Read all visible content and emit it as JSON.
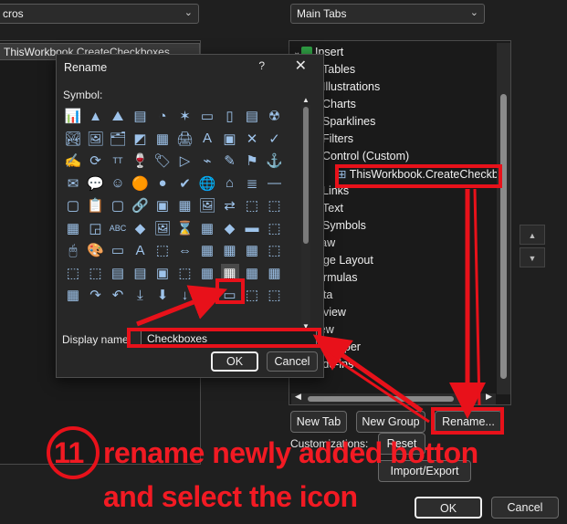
{
  "background": {
    "left_dropdown_value": "cros",
    "right_dropdown_value": "Main Tabs",
    "left_list_selected": "ThisWorkbook.CreateCheckboxes",
    "tree_items": [
      {
        "label": "Insert",
        "arrow": "down",
        "checkbox": true
      },
      {
        "label": "Tables",
        "arrow": "right"
      },
      {
        "label": "Illustrations",
        "arrow": "right"
      },
      {
        "label": "Charts",
        "arrow": "right"
      },
      {
        "label": "Sparklines",
        "arrow": "right"
      },
      {
        "label": "Filters",
        "arrow": "right"
      },
      {
        "label": "Control (Custom)",
        "arrow": "down"
      },
      {
        "label": "ThisWorkbook.CreateCheckb",
        "arrow": ""
      },
      {
        "label": "Links",
        "arrow": "right"
      },
      {
        "label": "Text",
        "arrow": "right"
      },
      {
        "label": "Symbols",
        "arrow": "right"
      },
      {
        "label": "raw",
        "arrow": ""
      },
      {
        "label": "age Layout",
        "arrow": ""
      },
      {
        "label": "ormulas",
        "arrow": ""
      },
      {
        "label": "ata",
        "arrow": ""
      },
      {
        "label": "eview",
        "arrow": ""
      },
      {
        "label": "iew",
        "arrow": ""
      },
      {
        "label": "eveloper",
        "arrow": ""
      },
      {
        "label": "Add-ins",
        "arrow": "",
        "checkbox": true
      }
    ],
    "new_tab_label": "New Tab",
    "new_group_label": "New Group",
    "rename_label": "Rename...",
    "customizations_label": "Customizations:",
    "reset_label": "Reset",
    "import_export_label": "Import/Export",
    "ok_label": "OK",
    "cancel_label": "Cancel"
  },
  "rename_dialog": {
    "title": "Rename",
    "help_glyph": "?",
    "close_glyph": "✕",
    "symbol_label": "Symbol:",
    "display_name_label": "Display name",
    "display_name_value": "Checkboxes",
    "ok_label": "OK",
    "cancel_label": "Cancel",
    "symbols": [
      [
        "📊",
        "▲",
        "⛰",
        "▤",
        "◔",
        "✶",
        "▭",
        "▯",
        "▤",
        "☢"
      ],
      [
        "🏞",
        "🖼",
        "🗂",
        "◩",
        "▦",
        "🖨",
        "A",
        "▣",
        "✕",
        "✓"
      ],
      [
        "✍",
        "⟳",
        "TT",
        "🍷",
        "🏷",
        "▷",
        "⌁",
        "✎",
        "⚑",
        "⚓"
      ],
      [
        "✉",
        "💬",
        "☺",
        "🟠",
        "●",
        "✔",
        "🌐",
        "⌂",
        "≣",
        "—"
      ],
      [
        "▢",
        "📋",
        "▢",
        "🔗",
        "▣",
        "▦",
        "🖼",
        "⇄",
        "⬚",
        "⬚"
      ],
      [
        "▦",
        "◲",
        "ABC",
        "◆",
        "🖼",
        "⌛",
        "▦",
        "◆",
        "▬",
        "⬚"
      ],
      [
        "🖱",
        "🎨",
        "▭",
        "A",
        "⬚",
        "⇔",
        "▦",
        "▦",
        "▦",
        "⬚"
      ],
      [
        "⬚",
        "⬚",
        "▤",
        "▤",
        "▣",
        "⬚",
        "▦",
        "▦",
        "▦",
        "▦"
      ],
      [
        "▦",
        "↷",
        "↶",
        "⤓",
        "⬇",
        "↓",
        "↑",
        "▭",
        "⬚",
        "⬚"
      ]
    ]
  },
  "annotation": {
    "step_number": "11",
    "line1": "rename newly added botton",
    "line2": "and select the icon",
    "color": "#e8111a"
  },
  "colors": {
    "background": "#1f1f1f",
    "dialog": "#272727",
    "icon_blue": "#9ec3ea",
    "annotation_red": "#e8111a"
  }
}
